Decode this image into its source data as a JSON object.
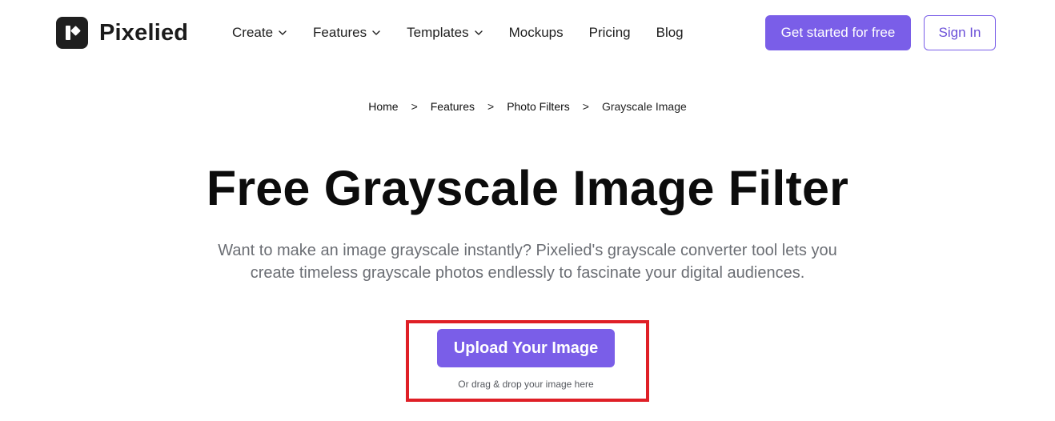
{
  "brand": {
    "name": "Pixelied"
  },
  "nav": {
    "items": [
      {
        "label": "Create",
        "has_dropdown": true
      },
      {
        "label": "Features",
        "has_dropdown": true
      },
      {
        "label": "Templates",
        "has_dropdown": true
      },
      {
        "label": "Mockups",
        "has_dropdown": false
      },
      {
        "label": "Pricing",
        "has_dropdown": false
      },
      {
        "label": "Blog",
        "has_dropdown": false
      }
    ],
    "cta_label": "Get started for free",
    "signin_label": "Sign In"
  },
  "breadcrumb": {
    "items": [
      "Home",
      "Features",
      "Photo Filters",
      "Grayscale Image"
    ],
    "separator": ">"
  },
  "hero": {
    "title": "Free Grayscale Image Filter",
    "description": "Want to make an image grayscale instantly? Pixelied's grayscale converter tool lets you create timeless grayscale photos endlessly to fascinate your digital audiences.",
    "upload_label": "Upload Your Image",
    "drop_hint": "Or drag & drop your image here"
  },
  "colors": {
    "accent": "#7a5ee8",
    "highlight_border": "#df1f26",
    "text_dark": "#0c0c0c",
    "text_muted": "#6b6e74"
  }
}
